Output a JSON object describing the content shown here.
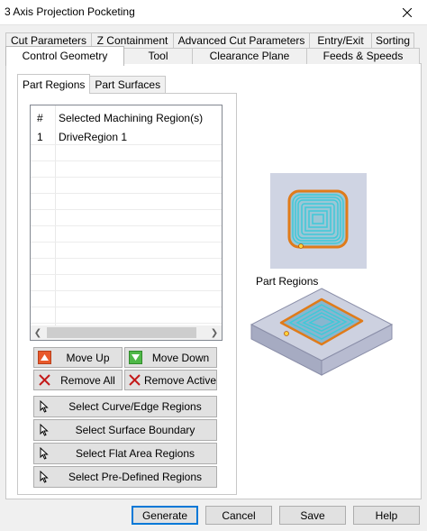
{
  "window": {
    "title": "3 Axis Projection Pocketing"
  },
  "tabs_row1": [
    "Cut Parameters",
    "Z Containment",
    "Advanced Cut Parameters",
    "Entry/Exit",
    "Sorting"
  ],
  "tabs_row2": [
    "Control Geometry",
    "Tool",
    "Clearance Plane",
    "Feeds & Speeds"
  ],
  "active_tab": "Control Geometry",
  "subtabs": [
    "Part Regions",
    "Part Surfaces"
  ],
  "active_subtab": "Part Regions",
  "region_list": {
    "headers": [
      "#",
      "Selected Machining Region(s)"
    ],
    "rows": [
      {
        "num": "1",
        "name": "DriveRegion 1"
      }
    ]
  },
  "buttons": {
    "move_up": "Move Up",
    "move_down": "Move Down",
    "remove_all": "Remove All",
    "remove_active": "Remove Active",
    "select_curve": "Select Curve/Edge Regions",
    "select_surface": "Select Surface Boundary",
    "select_flat": "Select Flat Area Regions",
    "select_predefined": "Select Pre-Defined Regions"
  },
  "preview": {
    "label": "Part Regions"
  },
  "footer": {
    "generate": "Generate",
    "cancel": "Cancel",
    "save": "Save",
    "help": "Help"
  },
  "colors": {
    "toolpath": "#3fc9d8",
    "region_outline": "#e07b1a",
    "accent": "#0078d7"
  }
}
